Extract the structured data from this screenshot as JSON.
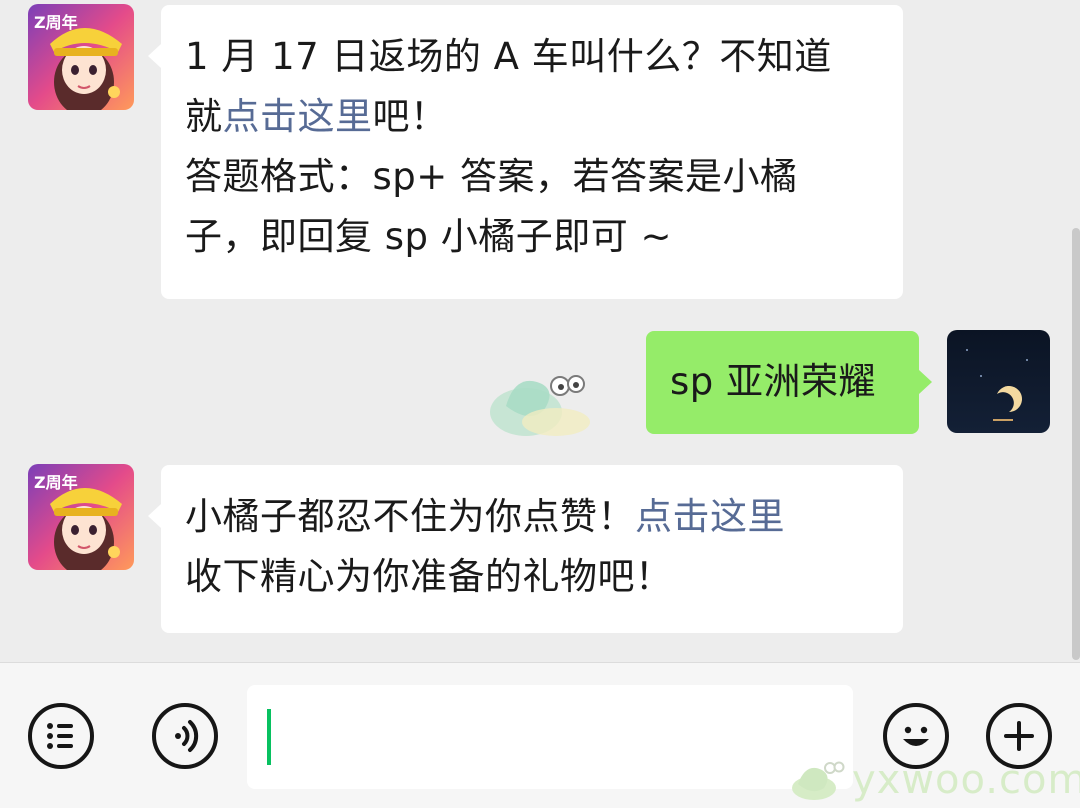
{
  "messages": [
    {
      "sender": "other",
      "lines": [
        {
          "text": "1 月 17 日返场的 A 车叫什么？不知道"
        },
        {
          "prefix": "就",
          "link": "点击这里",
          "suffix": "吧！"
        },
        {
          "text": "答题格式：sp+ 答案，若答案是小橘"
        },
        {
          "text": "子，即回复 sp 小橘子即可 ~"
        }
      ]
    },
    {
      "sender": "me",
      "text": "sp 亚洲荣耀"
    },
    {
      "sender": "other",
      "lines": [
        {
          "prefix": "小橘子都忍不住为你点赞！",
          "link": "点击这里"
        },
        {
          "text": "收下精心为你准备的礼物吧！"
        }
      ]
    }
  ],
  "avatar_badge": "Z周年",
  "watermark": "yxwoo.com",
  "icons": {
    "menu": "list-icon",
    "voice": "voice-icon",
    "emoji": "smile-icon",
    "plus": "plus-icon"
  },
  "colors": {
    "background": "#ededed",
    "outgoing_bubble": "#95ec69",
    "incoming_bubble": "#ffffff",
    "link": "#576b95",
    "caret": "#07c160"
  }
}
